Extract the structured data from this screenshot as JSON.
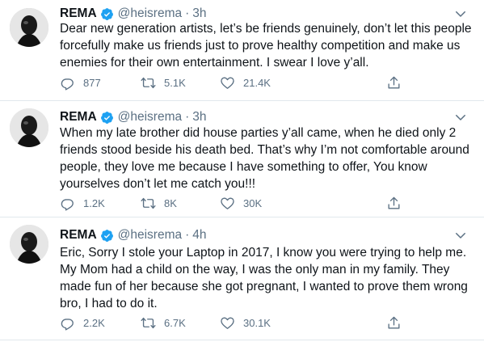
{
  "tweets": [
    {
      "name": "REMA",
      "handle": "@heisrema",
      "separator": "·",
      "time": "3h",
      "text": "Dear new generation artists, let’s be friends genuinely, don’t let this people forcefully make us friends just to prove healthy competition and make us enemies for their own entertainment. I swear I love y’all.",
      "replies": "877",
      "retweets": "5.1K",
      "likes": "21.4K"
    },
    {
      "name": "REMA",
      "handle": "@heisrema",
      "separator": "·",
      "time": "3h",
      "text": "When my late brother did house parties y’all came, when he died only 2 friends stood beside his death bed. That’s why I’m not comfortable around people, they love me because I have something to offer, You know yourselves don’t let me catch you!!!",
      "replies": "1.2K",
      "retweets": "8K",
      "likes": "30K"
    },
    {
      "name": "REMA",
      "handle": "@heisrema",
      "separator": "·",
      "time": "4h",
      "text": "Eric, Sorry I stole your Laptop in 2017, I know you were trying to help me. My Mom had a child on the way,  I was the only man in my family. They made fun of her because she got pregnant, I wanted to prove them wrong bro, I had to do it.",
      "replies": "2.2K",
      "retweets": "6.7K",
      "likes": "30.1K"
    }
  ],
  "icons": {
    "verified": "verified-badge-icon",
    "more": "chevron-down-icon",
    "reply": "reply-icon",
    "retweet": "retweet-icon",
    "like": "heart-icon",
    "share": "share-icon"
  },
  "colors": {
    "verified_blue": "#1da1f2",
    "secondary_text": "#5b7083",
    "divider": "#e1e8ed"
  }
}
